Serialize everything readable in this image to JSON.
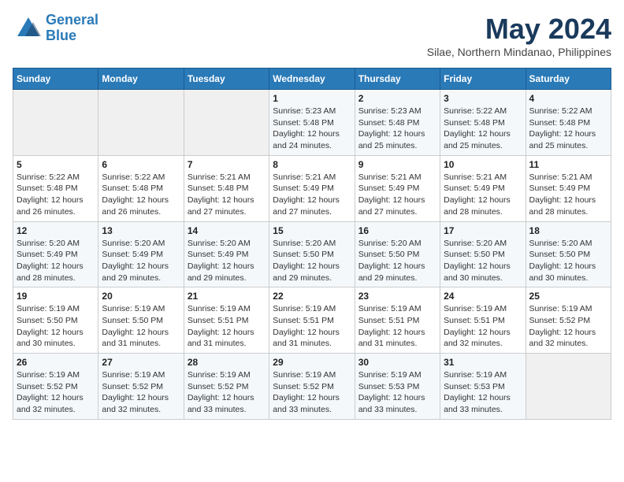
{
  "header": {
    "logo_line1": "General",
    "logo_line2": "Blue",
    "month": "May 2024",
    "location": "Silae, Northern Mindanao, Philippines"
  },
  "weekdays": [
    "Sunday",
    "Monday",
    "Tuesday",
    "Wednesday",
    "Thursday",
    "Friday",
    "Saturday"
  ],
  "weeks": [
    [
      {
        "day": "",
        "info": ""
      },
      {
        "day": "",
        "info": ""
      },
      {
        "day": "",
        "info": ""
      },
      {
        "day": "1",
        "info": "Sunrise: 5:23 AM\nSunset: 5:48 PM\nDaylight: 12 hours\nand 24 minutes."
      },
      {
        "day": "2",
        "info": "Sunrise: 5:23 AM\nSunset: 5:48 PM\nDaylight: 12 hours\nand 25 minutes."
      },
      {
        "day": "3",
        "info": "Sunrise: 5:22 AM\nSunset: 5:48 PM\nDaylight: 12 hours\nand 25 minutes."
      },
      {
        "day": "4",
        "info": "Sunrise: 5:22 AM\nSunset: 5:48 PM\nDaylight: 12 hours\nand 25 minutes."
      }
    ],
    [
      {
        "day": "5",
        "info": "Sunrise: 5:22 AM\nSunset: 5:48 PM\nDaylight: 12 hours\nand 26 minutes."
      },
      {
        "day": "6",
        "info": "Sunrise: 5:22 AM\nSunset: 5:48 PM\nDaylight: 12 hours\nand 26 minutes."
      },
      {
        "day": "7",
        "info": "Sunrise: 5:21 AM\nSunset: 5:48 PM\nDaylight: 12 hours\nand 27 minutes."
      },
      {
        "day": "8",
        "info": "Sunrise: 5:21 AM\nSunset: 5:49 PM\nDaylight: 12 hours\nand 27 minutes."
      },
      {
        "day": "9",
        "info": "Sunrise: 5:21 AM\nSunset: 5:49 PM\nDaylight: 12 hours\nand 27 minutes."
      },
      {
        "day": "10",
        "info": "Sunrise: 5:21 AM\nSunset: 5:49 PM\nDaylight: 12 hours\nand 28 minutes."
      },
      {
        "day": "11",
        "info": "Sunrise: 5:21 AM\nSunset: 5:49 PM\nDaylight: 12 hours\nand 28 minutes."
      }
    ],
    [
      {
        "day": "12",
        "info": "Sunrise: 5:20 AM\nSunset: 5:49 PM\nDaylight: 12 hours\nand 28 minutes."
      },
      {
        "day": "13",
        "info": "Sunrise: 5:20 AM\nSunset: 5:49 PM\nDaylight: 12 hours\nand 29 minutes."
      },
      {
        "day": "14",
        "info": "Sunrise: 5:20 AM\nSunset: 5:49 PM\nDaylight: 12 hours\nand 29 minutes."
      },
      {
        "day": "15",
        "info": "Sunrise: 5:20 AM\nSunset: 5:50 PM\nDaylight: 12 hours\nand 29 minutes."
      },
      {
        "day": "16",
        "info": "Sunrise: 5:20 AM\nSunset: 5:50 PM\nDaylight: 12 hours\nand 29 minutes."
      },
      {
        "day": "17",
        "info": "Sunrise: 5:20 AM\nSunset: 5:50 PM\nDaylight: 12 hours\nand 30 minutes."
      },
      {
        "day": "18",
        "info": "Sunrise: 5:20 AM\nSunset: 5:50 PM\nDaylight: 12 hours\nand 30 minutes."
      }
    ],
    [
      {
        "day": "19",
        "info": "Sunrise: 5:19 AM\nSunset: 5:50 PM\nDaylight: 12 hours\nand 30 minutes."
      },
      {
        "day": "20",
        "info": "Sunrise: 5:19 AM\nSunset: 5:50 PM\nDaylight: 12 hours\nand 31 minutes."
      },
      {
        "day": "21",
        "info": "Sunrise: 5:19 AM\nSunset: 5:51 PM\nDaylight: 12 hours\nand 31 minutes."
      },
      {
        "day": "22",
        "info": "Sunrise: 5:19 AM\nSunset: 5:51 PM\nDaylight: 12 hours\nand 31 minutes."
      },
      {
        "day": "23",
        "info": "Sunrise: 5:19 AM\nSunset: 5:51 PM\nDaylight: 12 hours\nand 31 minutes."
      },
      {
        "day": "24",
        "info": "Sunrise: 5:19 AM\nSunset: 5:51 PM\nDaylight: 12 hours\nand 32 minutes."
      },
      {
        "day": "25",
        "info": "Sunrise: 5:19 AM\nSunset: 5:52 PM\nDaylight: 12 hours\nand 32 minutes."
      }
    ],
    [
      {
        "day": "26",
        "info": "Sunrise: 5:19 AM\nSunset: 5:52 PM\nDaylight: 12 hours\nand 32 minutes."
      },
      {
        "day": "27",
        "info": "Sunrise: 5:19 AM\nSunset: 5:52 PM\nDaylight: 12 hours\nand 32 minutes."
      },
      {
        "day": "28",
        "info": "Sunrise: 5:19 AM\nSunset: 5:52 PM\nDaylight: 12 hours\nand 33 minutes."
      },
      {
        "day": "29",
        "info": "Sunrise: 5:19 AM\nSunset: 5:52 PM\nDaylight: 12 hours\nand 33 minutes."
      },
      {
        "day": "30",
        "info": "Sunrise: 5:19 AM\nSunset: 5:53 PM\nDaylight: 12 hours\nand 33 minutes."
      },
      {
        "day": "31",
        "info": "Sunrise: 5:19 AM\nSunset: 5:53 PM\nDaylight: 12 hours\nand 33 minutes."
      },
      {
        "day": "",
        "info": ""
      }
    ]
  ]
}
